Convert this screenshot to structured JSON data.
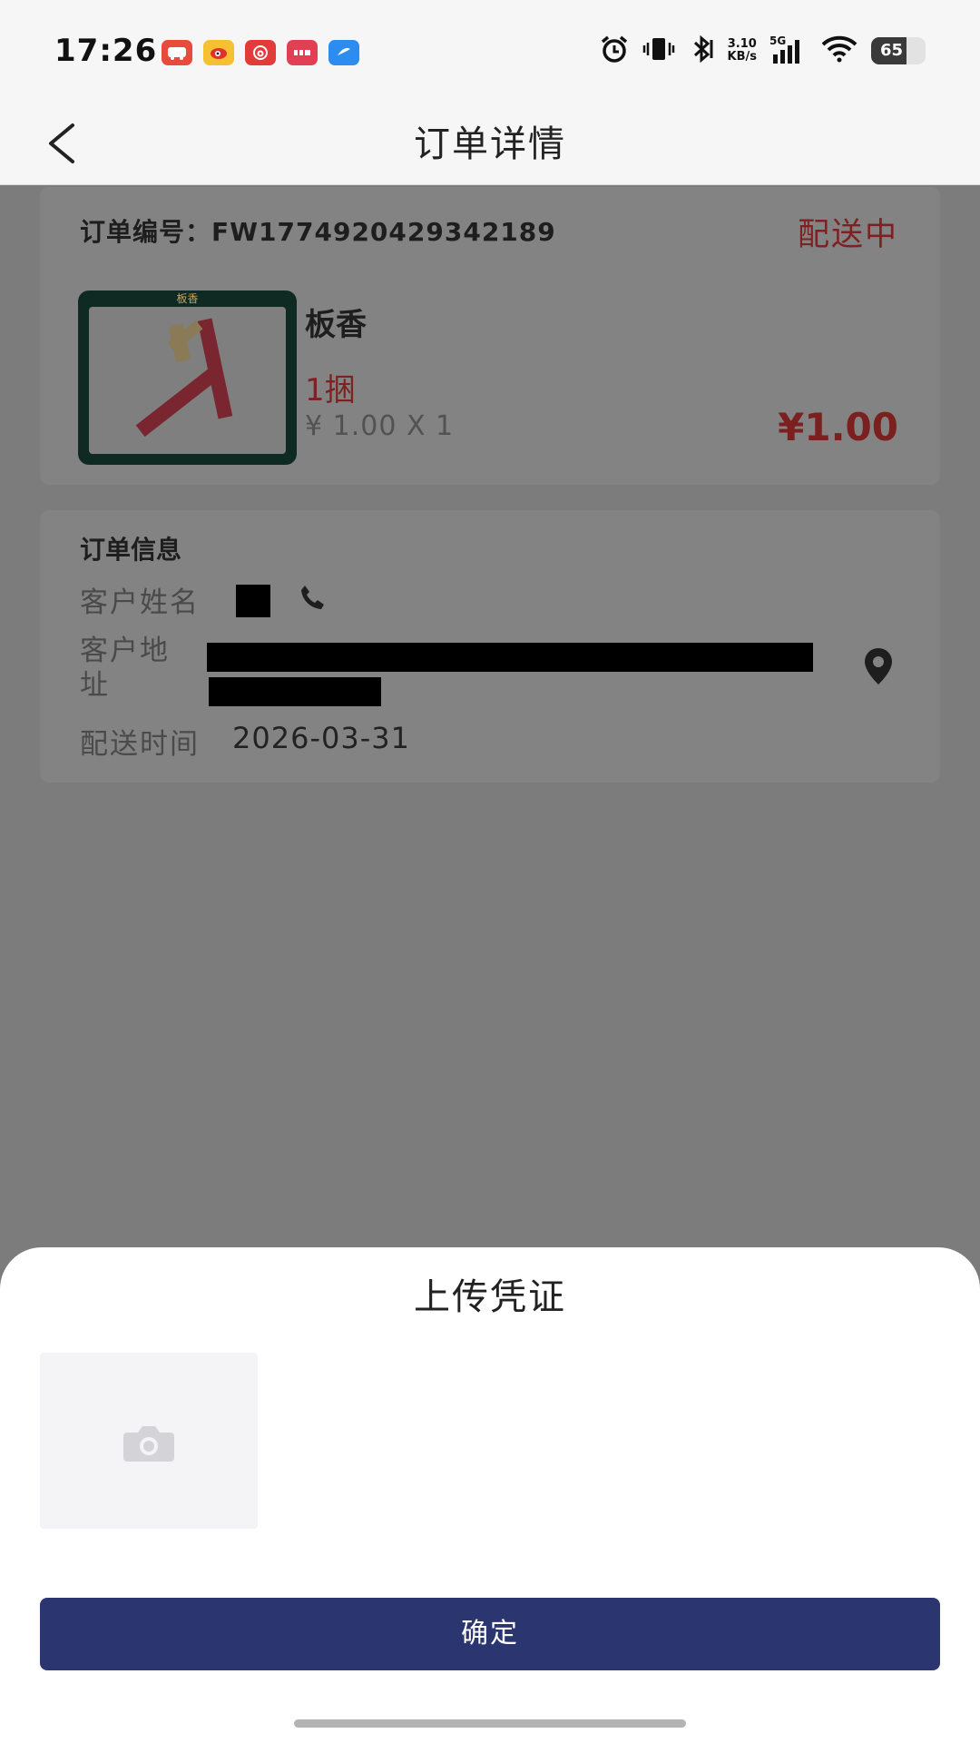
{
  "status_bar": {
    "time": "17:26",
    "network_speed_value": "3.10",
    "network_speed_unit": "KB/s",
    "network_type": "5G",
    "battery_level": "65",
    "notification_icons": [
      "travel-app-icon",
      "weibo-icon",
      "netease-music-icon",
      "news-app-icon",
      "browser-app-icon"
    ],
    "system_icons": [
      "alarm-icon",
      "vibrate-icon",
      "bluetooth-icon",
      "signal-icon",
      "wifi-icon",
      "battery-icon"
    ]
  },
  "header": {
    "title": "订单详情",
    "back_icon": "chevron-left-icon"
  },
  "order": {
    "order_number_label": "订单编号：",
    "order_number": "FW1774920429342189",
    "status": "配送中",
    "status_color": "#7d2222",
    "product": {
      "thumb_label": "板香",
      "name": "板香",
      "spec": "1捆",
      "unit_price_qty": "¥ 1.00 X 1",
      "total": "¥1.00"
    }
  },
  "order_info": {
    "title": "订单信息",
    "customer_name_label": "客户姓名",
    "customer_address_label": "客户地址",
    "delivery_time_label": "配送时间",
    "delivery_time": "2026-03-31",
    "phone_icon": "phone-icon",
    "location_icon": "location-pin-icon"
  },
  "sheet": {
    "title": "上传凭证",
    "upload_icon": "camera-icon",
    "confirm_label": "确定",
    "accent_color": "#2b3670"
  }
}
